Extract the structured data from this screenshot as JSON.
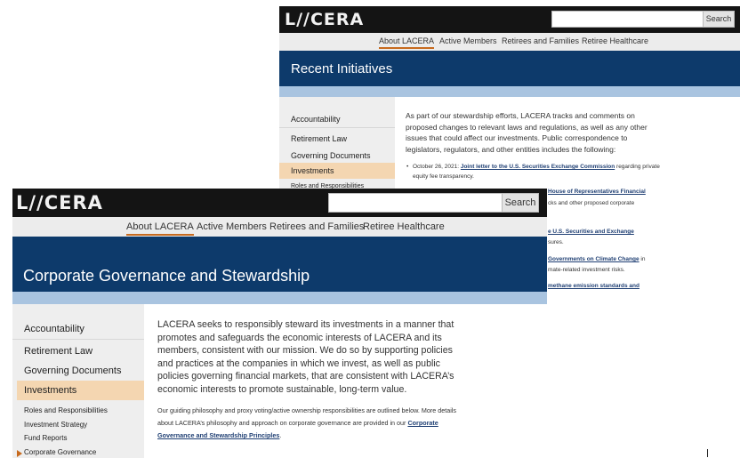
{
  "back": {
    "logo": "L/∕CERA",
    "search_button": "Search",
    "nav": [
      "About LACERA",
      "Active Members",
      "Retirees and Families",
      "Retiree Healthcare"
    ],
    "banner_title": "Recent Initiatives",
    "sidebar": [
      "Accountability",
      "Retirement Law",
      "Governing Documents",
      "Investments",
      "Roles and Responsibilities"
    ],
    "intro": "As part of our stewardship efforts, LACERA tracks and comments on proposed changes to relevant laws and regulations, as well as any other issues that could affect our investments. Public correspondence to legislators, regulators, and other entities includes the following:",
    "bullet1_prefix": "October 26, 2021: ",
    "bullet1_link": "Joint letter to the U.S. Securities Exchange Commission",
    "bullet1_suffix": " regarding private equity fee transparency.",
    "peek": {
      "l1": "House of Representatives Financial",
      "l2": "cks and other proposed corporate",
      "l3": "e U.S. Securities and Exchange",
      "l4": "sures.",
      "l5": "Governments on Climate Change",
      "l5b": " in",
      "l6": "mate-related investment risks.",
      "l7": "methane emission standards and"
    }
  },
  "front": {
    "logo": "L/∕CERA",
    "search_button": "Search",
    "nav": [
      "About LACERA",
      "Active Members",
      "Retirees and Families",
      "Retiree Healthcare"
    ],
    "banner_title": "Corporate Governance and Stewardship",
    "sidebar": [
      "Accountability",
      "Retirement Law",
      "Governing Documents",
      "Investments"
    ],
    "subitems": [
      "Roles and Responsibilities",
      "Investment Strategy",
      "Fund Reports",
      "Corporate Governance"
    ],
    "para1": "LACERA seeks to responsibly steward its investments in a manner that promotes and safeguards the economic interests of LACERA and its members, consistent with our mission. We do so by supporting policies and practices at the companies in which we invest, as well as public policies governing financial markets, that are consistent with LACERA’s economic interests to promote sustainable, long-term value.",
    "para2_prefix": "Our guiding philosophy and proxy voting/active ownership responsibilities are outlined below. More details about LACERA’s philosophy and approach on corporate governance are provided in our ",
    "para2_link": "Corporate Governance and Stewardship Principles",
    "para2_suffix": "."
  },
  "colors": {
    "topbar": "#141414",
    "banner": "#0d3a6b",
    "stripe": "#a9c4e0",
    "accent": "#c76a1e",
    "selected": "#f4d6b1"
  }
}
